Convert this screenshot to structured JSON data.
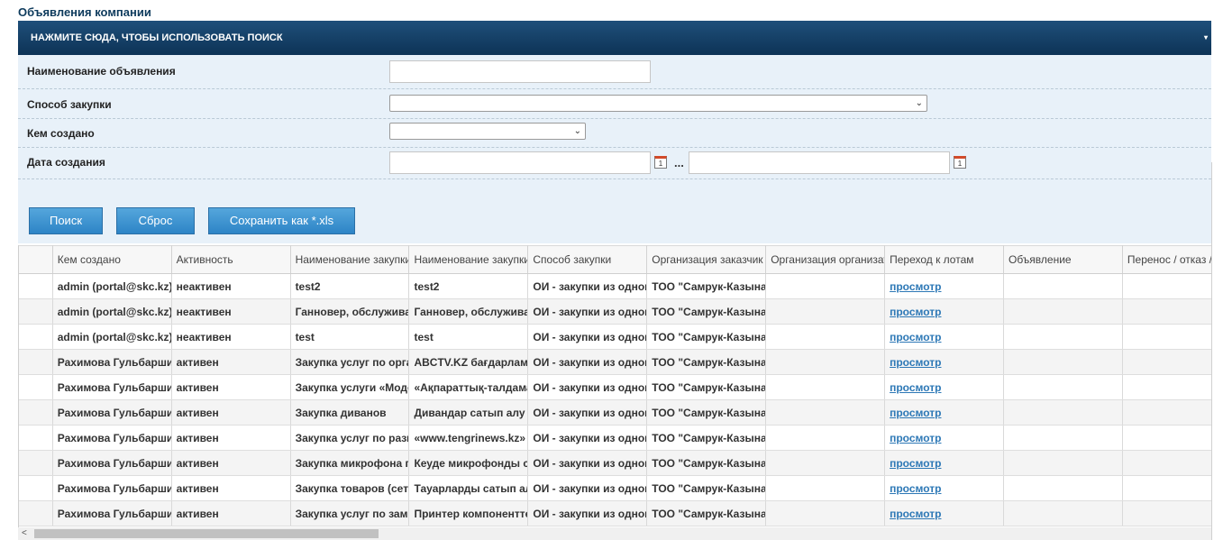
{
  "page": {
    "title": "Объявления компании"
  },
  "search_toggle": {
    "label": "НАЖМИТЕ СЮДА, ЧТОБЫ ИСПОЛЬЗОВАТЬ ПОИСК"
  },
  "form": {
    "name_label": "Наименование объявления",
    "name_value": "",
    "method_label": "Способ закупки",
    "method_value": "",
    "creator_label": "Кем создано",
    "creator_value": "",
    "date_label": "Дата создания",
    "date_from": "",
    "date_to": "",
    "range_separator": "...",
    "calendar_glyph": "1"
  },
  "buttons": {
    "search": "Поиск",
    "reset": "Сброс",
    "export": "Сохранить как *.xls"
  },
  "table": {
    "columns": [
      "",
      "Кем создано",
      "Активность",
      "Наименование закупки",
      "Наименование закупки",
      "Способ закупки",
      "Организация заказчик",
      "Организация организатор",
      "Переход к лотам",
      "Объявление",
      "Перенос / отказ / продление"
    ],
    "rows": [
      [
        "",
        "admin (portal@skc.kz)",
        "неактивен",
        "test2",
        "test2",
        "ОИ - закупки из одного источника",
        "ТОО \"Самрук-Казына Контракт\"",
        "",
        "просмотр",
        "",
        ""
      ],
      [
        "",
        "admin (portal@skc.kz)",
        "неактивен",
        "Ганновер, обслуживание",
        "Ганновер, обслуживание",
        "ОИ - закупки из одного источника",
        "ТОО \"Самрук-Казына Контракт\"",
        "",
        "просмотр",
        "",
        ""
      ],
      [
        "",
        "admin (portal@skc.kz)",
        "неактивен",
        "test",
        "test",
        "ОИ - закупки из одного источника",
        "ТОО \"Самрук-Казына Контракт\"",
        "",
        "просмотр",
        "",
        ""
      ],
      [
        "",
        "Рахимова Гульбаршин",
        "активен",
        "Закупка услуг по организации",
        "ABCTV.KZ бағдарламасы",
        "ОИ - закупки из одного источника",
        "ТОО \"Самрук-Казына Контракт\"",
        "",
        "просмотр",
        "",
        ""
      ],
      [
        "",
        "Рахимова Гульбаршин",
        "активен",
        "Закупка услуги «Модератор»",
        "«Ақпараттық-талдамалық",
        "ОИ - закупки из одного источника",
        "ТОО \"Самрук-Казына Контракт\"",
        "",
        "просмотр",
        "",
        ""
      ],
      [
        "",
        "Рахимова Гульбаршин",
        "активен",
        "Закупка диванов",
        "Дивандар сатып алу",
        "ОИ - закупки из одного источника",
        "ТОО \"Самрук-Казына Контракт\"",
        "",
        "просмотр",
        "",
        ""
      ],
      [
        "",
        "Рахимова Гульбаршин",
        "активен",
        "Закупка услуг по размещению",
        "«www.tengrinews.kz»",
        "ОИ - закупки из одного источника",
        "ТОО \"Самрук-Казына Контракт\"",
        "",
        "просмотр",
        "",
        ""
      ],
      [
        "",
        "Рахимова Гульбаршин",
        "активен",
        "Закупка микрофона петлички",
        "Кеуде микрофонды сатып алу",
        "ОИ - закупки из одного источника",
        "ТОО \"Самрук-Казына Контракт\"",
        "",
        "просмотр",
        "",
        ""
      ],
      [
        "",
        "Рахимова Гульбаршин",
        "активен",
        "Закупка товаров (сетевое)",
        "Тауарларды сатып алу",
        "ОИ - закупки из одного источника",
        "ТОО \"Самрук-Казына Контракт\"",
        "",
        "просмотр",
        "",
        ""
      ],
      [
        "",
        "Рахимова Гульбаршин",
        "активен",
        "Закупка услуг по замене",
        "Принтер компоненттерін",
        "ОИ - закупки из одного источника",
        "ТОО \"Самрук-Казына Контракт\"",
        "",
        "просмотр",
        "",
        ""
      ]
    ]
  },
  "scrollbar": {
    "left_arrow_glyph": "<"
  },
  "toggle_caret_glyph": "▾",
  "select_chevron_glyph": "⌄"
}
